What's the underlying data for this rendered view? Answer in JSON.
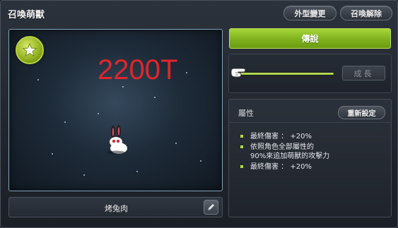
{
  "window": {
    "title": "召喚萌獸"
  },
  "header_buttons": {
    "outfit_label": "外型變更",
    "dismiss_label": "召喚解除"
  },
  "preview": {
    "overlay_text": "2200T",
    "badge_icon": "star-icon",
    "pet_name": "烤兔肉",
    "edit_icon": "pencil-icon"
  },
  "tier": {
    "label": "傳說"
  },
  "growth": {
    "button_label": "成長",
    "progress": 1.0,
    "cursor_icon": "pointing-hand-icon"
  },
  "attributes": {
    "title": "屬性",
    "reset_label": "重新設定",
    "items": [
      {
        "line1": "最終傷害 ： +20%",
        "line2": ""
      },
      {
        "line1": "依照角色全部屬性的",
        "line2": "90%來追加萌獸的攻擊力"
      },
      {
        "line1": "最終傷害 ： +20%",
        "line2": ""
      }
    ]
  },
  "colors": {
    "accent_green": "#8cc12a",
    "overlay_red": "#e2252a",
    "stage_border": "#7fa4b8"
  }
}
